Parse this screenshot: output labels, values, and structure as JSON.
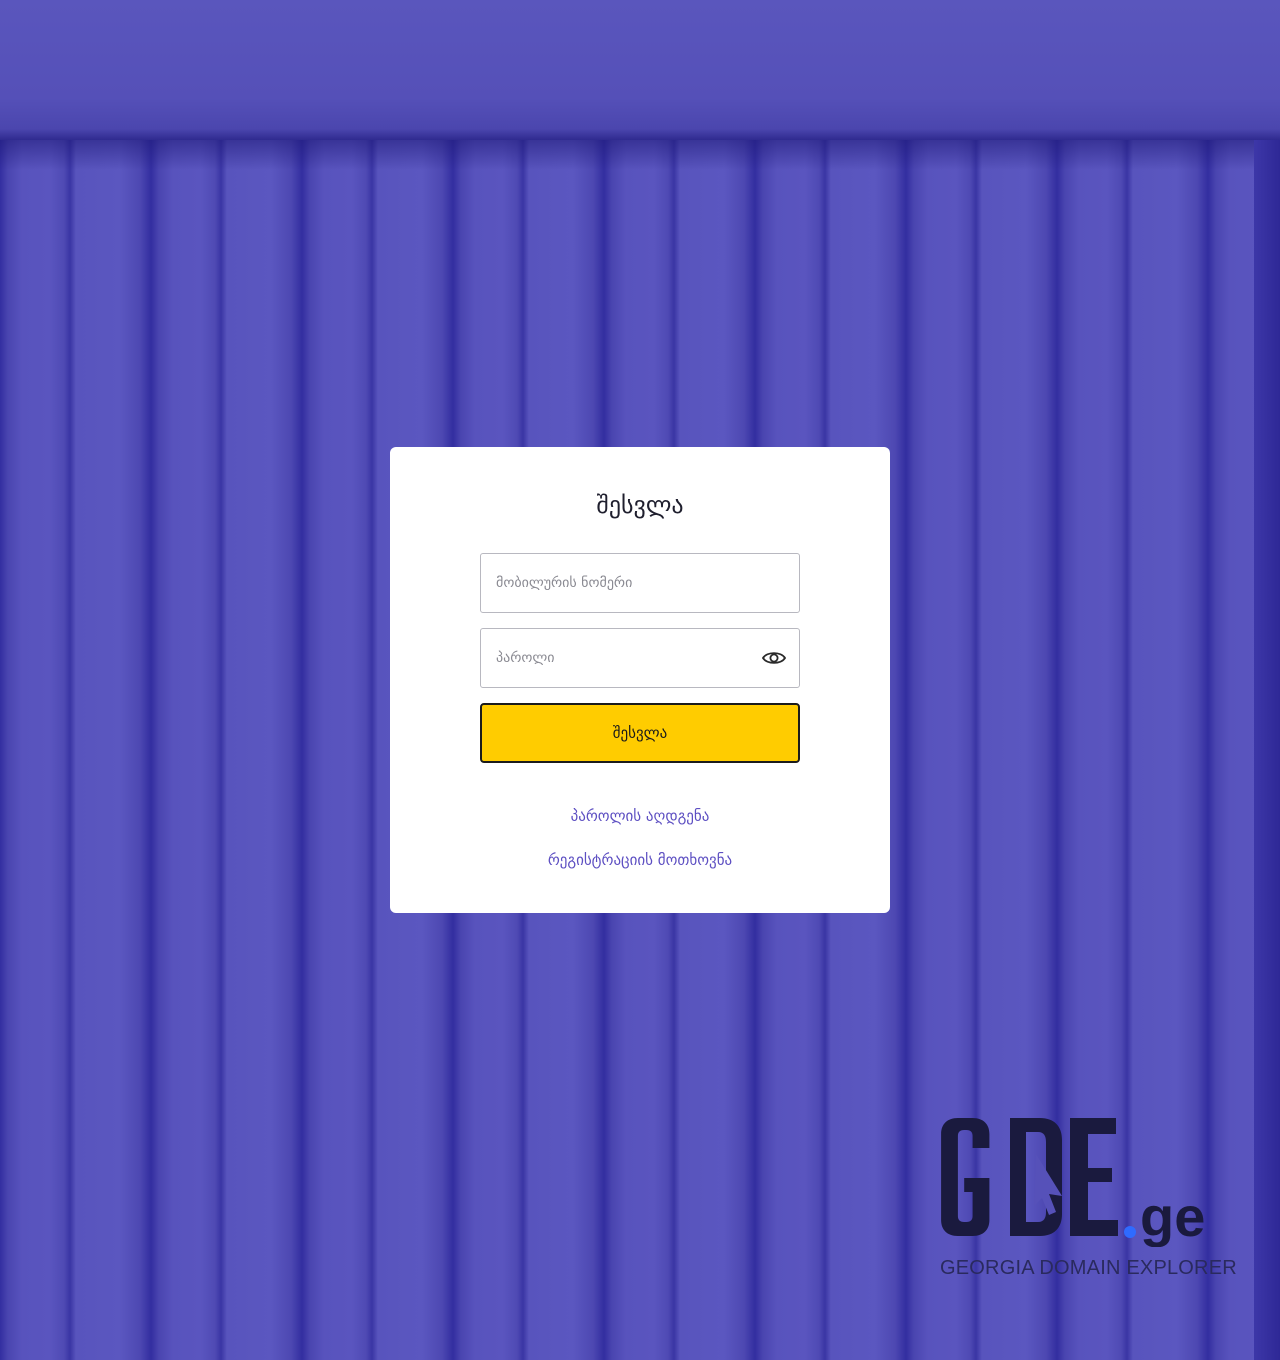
{
  "login": {
    "title": "შესვლა",
    "phone_placeholder": "მობილურის ნომერი",
    "password_placeholder": "პაროლი",
    "submit_label": "შესვლა",
    "forgot_password_link": "პაროლის აღდგენა",
    "register_link": "რეგისტრაციის მოთხოვნა",
    "password_toggle_icon": "eye-icon"
  },
  "watermark": {
    "logo_text": "GDE.ge",
    "tagline": "GEORGIA DOMAIN EXPLORER"
  },
  "colors": {
    "background": "#5651b9",
    "card": "#ffffff",
    "button": "#ffcc00",
    "link": "#5d4fc2",
    "logo_dot": "#2f6bff"
  }
}
